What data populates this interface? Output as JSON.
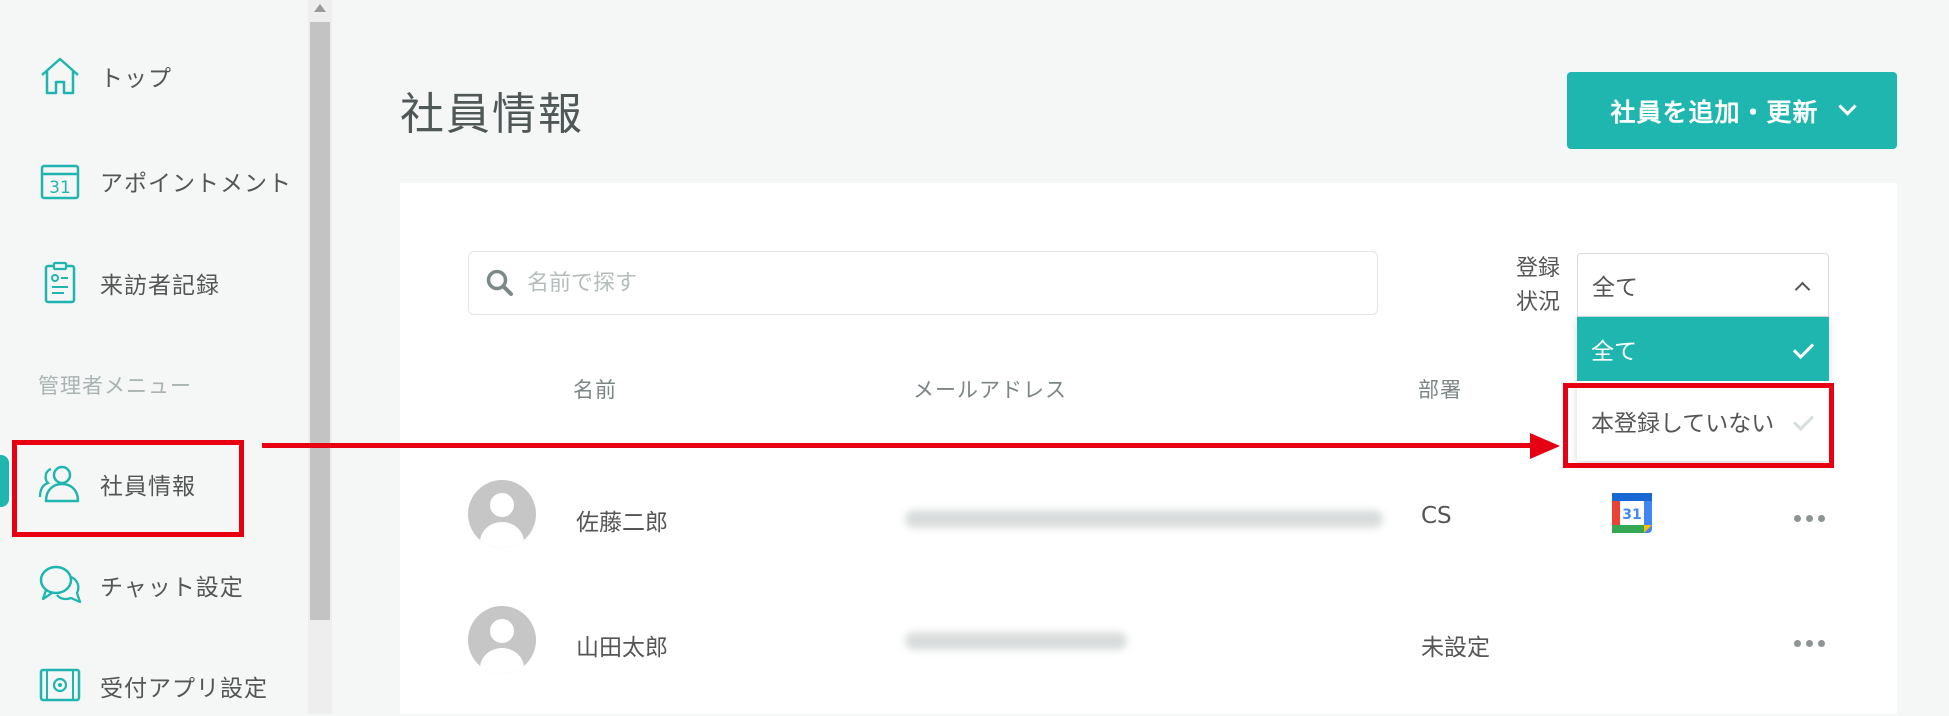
{
  "sidebar": {
    "items": [
      {
        "label": "トップ",
        "icon": "home-icon"
      },
      {
        "label": "アポイントメント",
        "icon": "calendar-icon"
      },
      {
        "label": "来訪者記録",
        "icon": "clipboard-icon"
      },
      {
        "label": "社員情報",
        "icon": "users-icon"
      },
      {
        "label": "チャット設定",
        "icon": "chat-icon"
      },
      {
        "label": "受付アプリ設定",
        "icon": "tablet-gear-icon"
      }
    ],
    "section_label": "管理者メニュー",
    "active_index": 3
  },
  "page": {
    "title": "社員情報",
    "add_button": "社員を追加・更新"
  },
  "search": {
    "placeholder": "名前で探す"
  },
  "filter": {
    "label_line1": "登録",
    "label_line2": "状況",
    "selected": "全て",
    "options": [
      "全て",
      "本登録していない"
    ]
  },
  "table": {
    "headers": {
      "name": "名前",
      "email": "メールアドレス",
      "dept": "部署"
    },
    "rows": [
      {
        "name": "佐藤二郎",
        "dept": "CS",
        "has_calendar": true
      },
      {
        "name": "山田太郎",
        "dept": "未設定",
        "has_calendar": false
      }
    ]
  },
  "colors": {
    "accent": "#1fb6b0",
    "annotation": "#e60012"
  },
  "calendar_icon_text": "31"
}
